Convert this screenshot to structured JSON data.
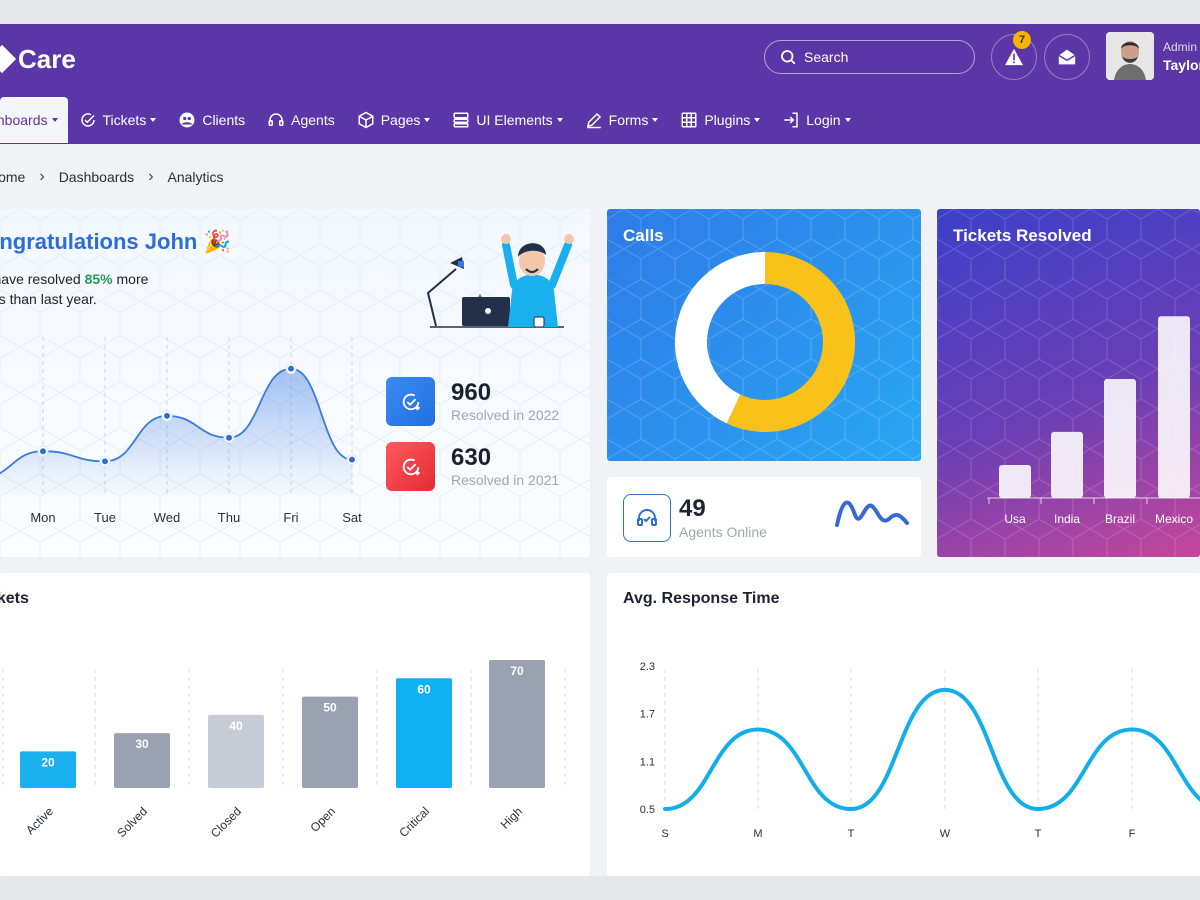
{
  "brand": {
    "name": "Care"
  },
  "header": {
    "search_label": "Search",
    "notifications_count": "7",
    "user": {
      "role": "Admin",
      "name": "Taylor"
    }
  },
  "nav": [
    {
      "label": "Dashboards",
      "dropdown": true,
      "active": true
    },
    {
      "label": "Tickets",
      "dropdown": true
    },
    {
      "label": "Clients",
      "dropdown": false
    },
    {
      "label": "Agents",
      "dropdown": false
    },
    {
      "label": "Pages",
      "dropdown": true
    },
    {
      "label": "UI Elements",
      "dropdown": true
    },
    {
      "label": "Forms",
      "dropdown": true
    },
    {
      "label": "Plugins",
      "dropdown": true
    },
    {
      "label": "Login",
      "dropdown": true
    }
  ],
  "breadcrumb": [
    "Home",
    "Dashboards",
    "Analytics"
  ],
  "welcome": {
    "title": "Congratulations John",
    "line1_pre": "You have resolved ",
    "line1_highlight": "85%",
    "line1_post": " more",
    "line2": "tickets than last year.",
    "stats": [
      {
        "value": "960",
        "label": "Resolved in 2022",
        "color": "#2f7be8"
      },
      {
        "value": "630",
        "label": "Resolved in 2021",
        "color": "#f0434a"
      }
    ]
  },
  "calls": {
    "title": "Calls"
  },
  "agents_online": {
    "value": "49",
    "label": "Agents Online"
  },
  "tickets_resolved": {
    "title": "Tickets Resolved"
  },
  "tickets_card": {
    "title": "Tickets"
  },
  "response_card": {
    "title": "Avg. Response Time"
  },
  "colors": {
    "primary": "#5a36a6",
    "accent_blue": "#1ab0ef",
    "success": "#1f9d55",
    "badge": "#f4b400"
  },
  "chart_data": [
    {
      "type": "area",
      "categories": [
        "Mon",
        "Tue",
        "Wed",
        "Thu",
        "Fri",
        "Sat"
      ],
      "values": [
        46,
        40,
        67,
        54,
        95,
        41
      ],
      "ylim": [
        20,
        115
      ]
    },
    {
      "type": "pie",
      "labels": [
        "",
        ""
      ],
      "values": [
        43,
        57
      ],
      "colors": [
        "#ffffff",
        "#f9c21a"
      ]
    },
    {
      "type": "bar",
      "title": "Tickets Resolved",
      "categories": [
        "Usa",
        "India",
        "Brazil",
        "Mexico"
      ],
      "values": [
        20,
        40,
        72,
        110
      ],
      "ylim": [
        0,
        115
      ]
    },
    {
      "type": "bar",
      "title": "Tickets",
      "categories": [
        "Active",
        "Solved",
        "Closed",
        "Open",
        "Critical",
        "High"
      ],
      "values": [
        20,
        30,
        40,
        50,
        60,
        70
      ],
      "ylim": [
        0,
        80
      ],
      "colors": [
        "#1ab0ef",
        "#9aa2b2",
        "#c7cbd6",
        "#9aa2b2",
        "#0fb1f2",
        "#9aa2b2"
      ]
    },
    {
      "type": "line",
      "title": "Avg. Response Time",
      "categories": [
        "S",
        "M",
        "T",
        "W",
        "T",
        "F"
      ],
      "values": [
        0.5,
        1.5,
        0.5,
        2.0,
        0.5,
        1.5
      ],
      "yticks": [
        0.5,
        1.1,
        1.7,
        2.3
      ],
      "ylim": [
        0.5,
        2.3
      ]
    }
  ]
}
